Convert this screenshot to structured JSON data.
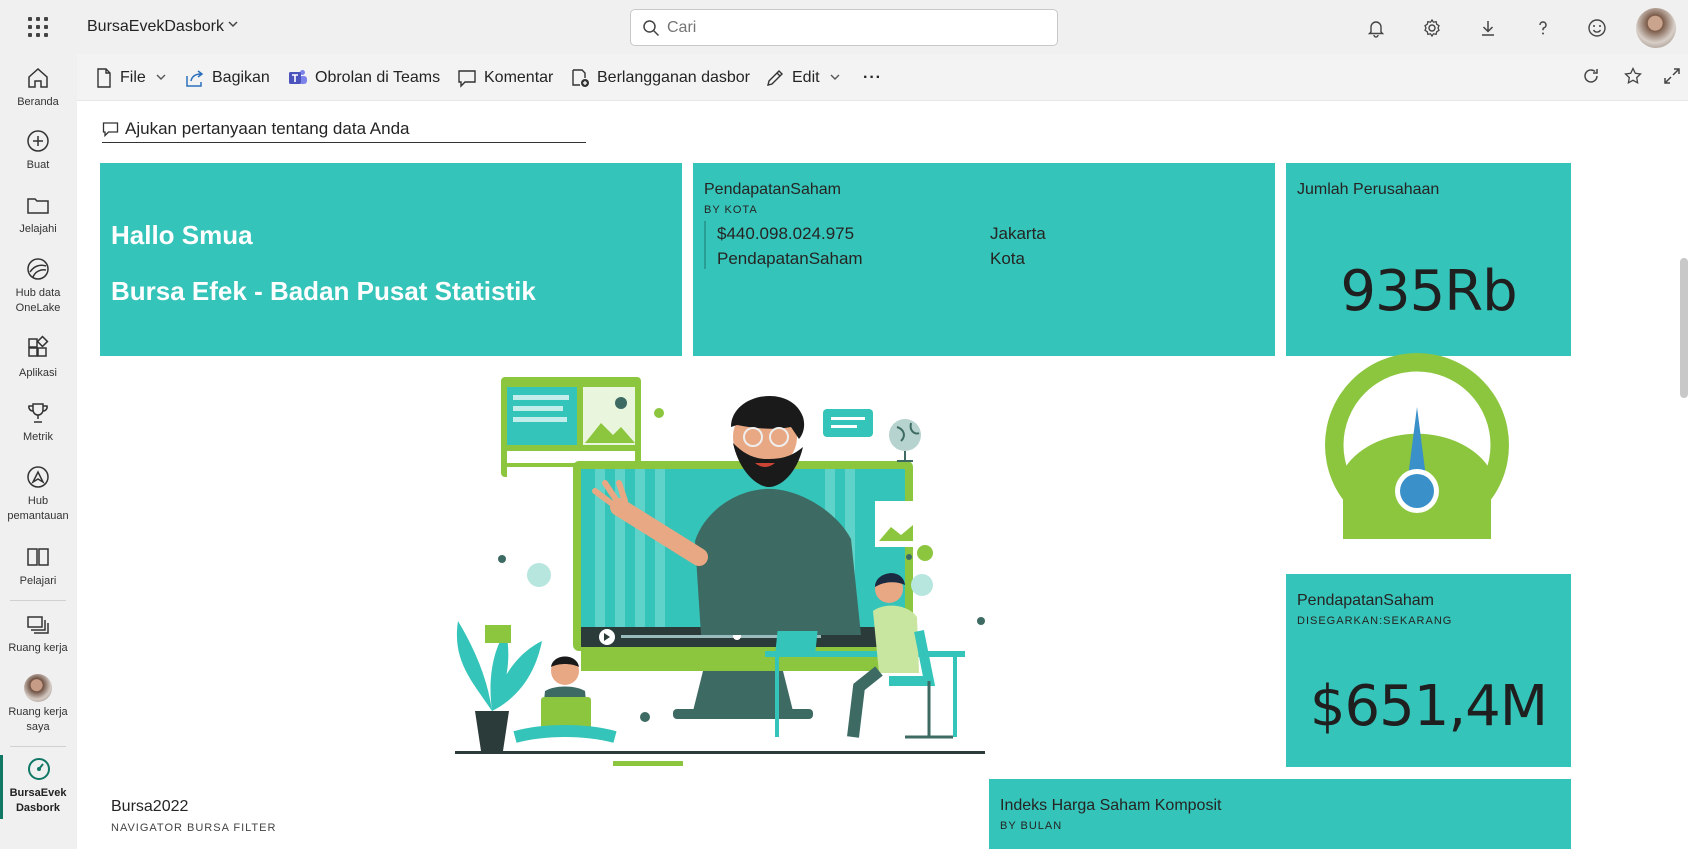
{
  "header": {
    "app_title": "BursaEvekDasbork",
    "search_placeholder": "Cari"
  },
  "leftnav": {
    "items": [
      {
        "label": "Beranda"
      },
      {
        "label": "Buat"
      },
      {
        "label": "Jelajahi"
      },
      {
        "label": "Hub data OneLake"
      },
      {
        "label": "Aplikasi"
      },
      {
        "label": "Metrik"
      },
      {
        "label": "Hub pemantauan"
      },
      {
        "label": "Pelajari"
      },
      {
        "label": "Ruang kerja"
      },
      {
        "label": "Ruang kerja saya"
      },
      {
        "label": "BursaEvekDasbork"
      }
    ]
  },
  "toolbar": {
    "file": "File",
    "share": "Bagikan",
    "teams": "Obrolan di Teams",
    "comment": "Komentar",
    "subscribe": "Berlangganan dasbor",
    "edit": "Edit",
    "more": "···"
  },
  "qna": {
    "placeholder": "Ajukan pertanyaan tentang data Anda"
  },
  "tiles": {
    "hello": {
      "line1": "Hallo Smua",
      "line2": "Bursa Efek - Badan Pusat Statistik"
    },
    "pendapatan_kota": {
      "title": "PendapatanSaham",
      "subtitle": "BY KOTA",
      "value": "$440.098.024.975",
      "value_label": "PendapatanSaham",
      "city": "Jakarta",
      "city_label": "Kota"
    },
    "jumlah": {
      "title": "Jumlah Perusahaan",
      "value": "935Rb"
    },
    "pendapatan_total": {
      "title": "PendapatanSaham",
      "subtitle": "DISEGARKAN:SEKARANG",
      "value": "$651,4M"
    },
    "bursa2022": {
      "title": "Bursa2022",
      "subtitle": "NAVIGATOR BURSA FILTER"
    },
    "ihsg": {
      "title": "Indeks Harga Saham Komposit",
      "subtitle": "BY BULAN"
    }
  },
  "colors": {
    "tile_teal": "#35c4b9",
    "accent_green": "#8cc63f",
    "gauge_needle": "#3a90c8",
    "dark_teal": "#3d6b63"
  },
  "icons": [
    "waffle-icon",
    "chevron-down-icon",
    "search-icon",
    "bell-icon",
    "gear-icon",
    "download-icon",
    "help-icon",
    "smiley-icon",
    "home-icon",
    "plus-icon",
    "folder-icon",
    "onelake-icon",
    "apps-icon",
    "trophy-icon",
    "monitor-icon",
    "book-icon",
    "workspaces-icon",
    "gauge-icon",
    "file-icon",
    "share-icon",
    "teams-icon",
    "comment-icon",
    "subscribe-icon",
    "edit-icon",
    "refresh-icon",
    "star-icon",
    "fullscreen-icon"
  ]
}
